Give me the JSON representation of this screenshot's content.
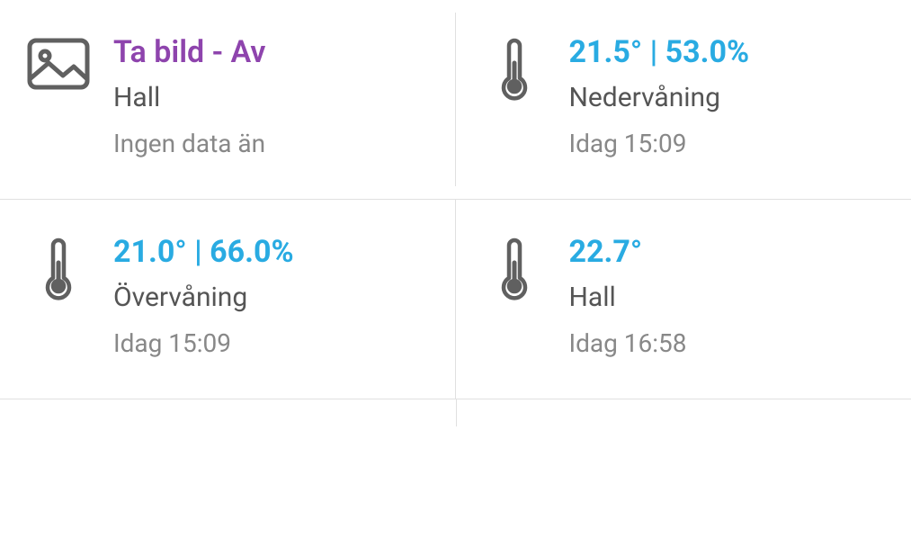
{
  "tiles": [
    {
      "title": "Ta bild - Av",
      "title_class": "camera",
      "subtitle": "Hall",
      "meta": "Ingen data än",
      "icon": "image"
    },
    {
      "title": "21.5° | 53.0%",
      "title_class": "sensor",
      "subtitle": "Nedervåning",
      "meta": "Idag 15:09",
      "icon": "thermometer"
    },
    {
      "title": "21.0° | 66.0%",
      "title_class": "sensor",
      "subtitle": "Övervåning",
      "meta": "Idag 15:09",
      "icon": "thermometer"
    },
    {
      "title": "22.7°",
      "title_class": "sensor",
      "subtitle": "Hall",
      "meta": "Idag 16:58",
      "icon": "thermometer"
    }
  ]
}
